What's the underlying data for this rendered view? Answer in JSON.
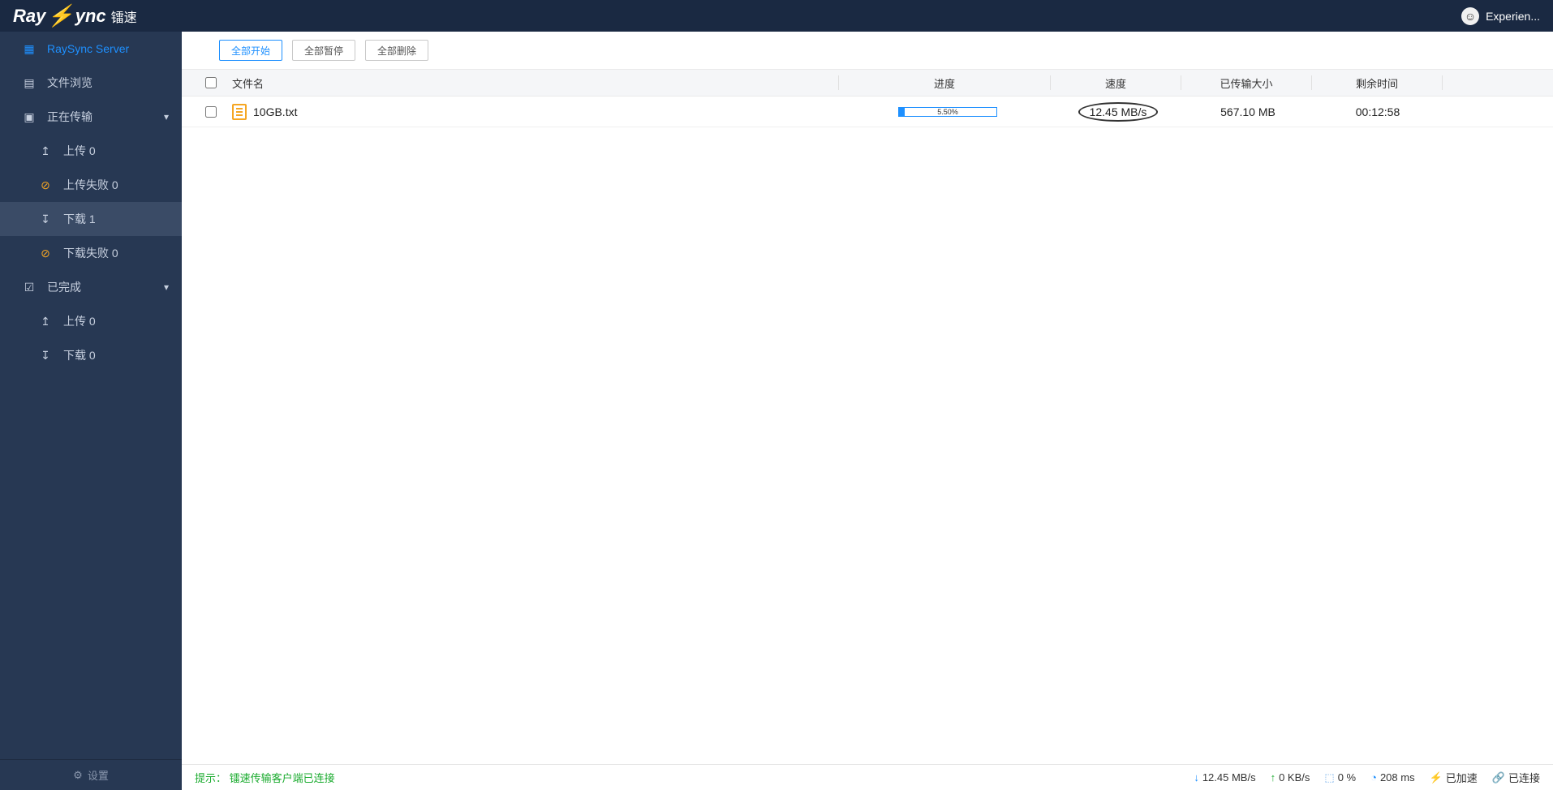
{
  "header": {
    "logo_text_a": "Ray",
    "logo_text_b": "ync",
    "logo_cn": "镭速",
    "user_name": "Experien..."
  },
  "sidebar": {
    "server": "RaySync Server",
    "file_browse": "文件浏览",
    "transferring": "正在传输",
    "upload": "上传 0",
    "upload_failed": "上传失败 0",
    "download": "下载 1",
    "download_failed": "下载失败 0",
    "completed": "已完成",
    "completed_upload": "上传 0",
    "completed_download": "下载 0",
    "settings": "设置"
  },
  "toolbar": {
    "start_all": "全部开始",
    "pause_all": "全部暂停",
    "delete_all": "全部删除"
  },
  "columns": {
    "filename": "文件名",
    "progress": "进度",
    "speed": "速度",
    "transferred": "已传输大小",
    "remaining": "剩余时间"
  },
  "rows": [
    {
      "name": "10GB.txt",
      "progress_pct": "5.50%",
      "progress_width": "5.5%",
      "speed": "12.45 MB/s",
      "transferred": "567.10 MB",
      "remaining": "00:12:58"
    }
  ],
  "statusbar": {
    "tip_label": "提示：",
    "tip_text": "镭速传输客户端已连接",
    "down_speed": "12.45 MB/s",
    "up_speed": "0 KB/s",
    "loss": "0 %",
    "latency": "208 ms",
    "boost": "已加速",
    "connected": "已连接"
  }
}
